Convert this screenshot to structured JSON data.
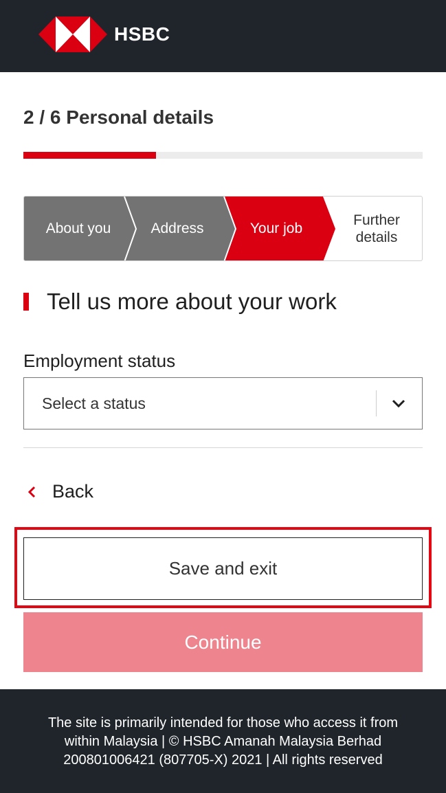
{
  "header": {
    "brand": "HSBC",
    "brand_colors": {
      "red": "#db0011",
      "dark": "#1f252b"
    },
    "logo_icon": "hsbc-hexagon-logo"
  },
  "form": {
    "step_title": "2 / 6 Personal details",
    "progress_fraction": 0.333,
    "steps": [
      {
        "label": "About you",
        "state": "done"
      },
      {
        "label": "Address",
        "state": "done"
      },
      {
        "label": "Your job",
        "state": "current"
      },
      {
        "label": "Further details",
        "state": "future"
      }
    ],
    "section_heading": "Tell us more about your work",
    "employment": {
      "label": "Employment status",
      "placeholder": "Select a status",
      "icon": "chevron-down-icon"
    }
  },
  "nav": {
    "back_label": "Back",
    "back_icon": "chevron-left-icon",
    "save_label": "Save and exit",
    "continue_label": "Continue",
    "continue_color": "#ee848e",
    "highlight_color": "#e30613"
  },
  "footer": {
    "line1": "The site is primarily intended for those who access it from",
    "line2": "within Malaysia | © HSBC Amanah Malaysia Berhad",
    "line3": "200801006421 (807705-X) 2021 | All rights reserved"
  }
}
